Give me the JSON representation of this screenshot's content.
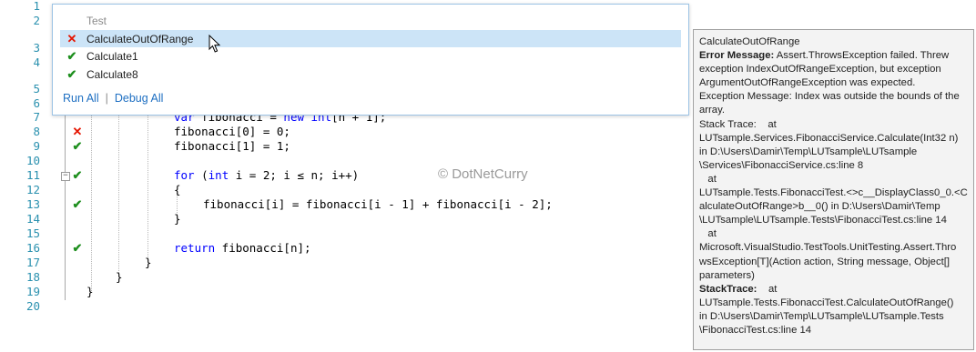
{
  "editor": {
    "line_numbers": [
      "1",
      "2",
      "3",
      "4",
      "5",
      "6",
      "7",
      "8",
      "9",
      "10",
      "11",
      "12",
      "13",
      "14",
      "15",
      "16",
      "17",
      "18",
      "19",
      "20"
    ],
    "code": {
      "l7_kw1": "var",
      "l7_mid": " fibonacci = ",
      "l7_kw2": "new",
      "l7_sp": " ",
      "l7_kw3": "int",
      "l7_end": "[n + 1];",
      "l8": "fibonacci[0] = 0;",
      "l9": "fibonacci[1] = 1;",
      "l11_kw1": "for",
      "l11_a": " (",
      "l11_kw2": "int",
      "l11_b": " i = 2; i ≤ n; i++)",
      "l12": "{",
      "l13": "fibonacci[i] = fibonacci[i - 1] + fibonacci[i - 2];",
      "l14": "}",
      "l16_kw": "return",
      "l16_rest": " fibonacci[n];",
      "l17": "}",
      "l18": "}",
      "l19": "}"
    },
    "watermark": "© DotNetCurry"
  },
  "popup": {
    "header": "Test",
    "tests": [
      {
        "name": "CalculateOutOfRange",
        "status": "fail",
        "icon": "✕"
      },
      {
        "name": "Calculate1",
        "status": "pass",
        "icon": "✔"
      },
      {
        "name": "Calculate8",
        "status": "pass",
        "icon": "✔"
      }
    ],
    "run_all": "Run All",
    "separator": "|",
    "debug_all": "Debug All"
  },
  "detail": {
    "title": "CalculateOutOfRange",
    "error_label": "Error Message:",
    "error_text_1": " Assert.ThrowsException failed. Threw",
    "error_text_2": "exception IndexOutOfRangeException, but exception",
    "error_text_3": "ArgumentOutOfRangeException was expected.",
    "error_text_4": "Exception Message: Index was outside the bounds of the",
    "error_text_5": "array.",
    "stack1_1": "Stack Trace:    at",
    "stack1_2": "LUTsample.Services.FibonacciService.Calculate(Int32 n)",
    "stack1_3": "in D:\\Users\\Damir\\Temp\\LUTsample\\LUTsample",
    "stack1_4": "\\Services\\FibonacciService.cs:line 8",
    "stack1_5": "   at",
    "stack1_6": "LUTsample.Tests.FibonacciTest.<>c__DisplayClass0_0.<C",
    "stack1_7": "alculateOutOfRange>b__0() in D:\\Users\\Damir\\Temp",
    "stack1_8": "\\LUTsample\\LUTsample.Tests\\FibonacciTest.cs:line 14",
    "stack1_9": "   at",
    "stack1_10": "Microsoft.VisualStudio.TestTools.UnitTesting.Assert.Thro",
    "stack1_11": "wsException[T](Action action, String message, Object[]",
    "stack1_12": "parameters)",
    "stack2_label": "StackTrace:",
    "stack2_1": "    at",
    "stack2_2": "LUTsample.Tests.FibonacciTest.CalculateOutOfRange()",
    "stack2_3": "in D:\\Users\\Damir\\Temp\\LUTsample\\LUTsample.Tests",
    "stack2_4": "\\FibonacciTest.cs:line 14"
  },
  "colors": {
    "line_number": "#2b91af",
    "keyword": "#0000ff",
    "pass": "#1e8f1e",
    "fail": "#e51400",
    "link": "#1e6fc2",
    "selection": "#cce4f7"
  }
}
